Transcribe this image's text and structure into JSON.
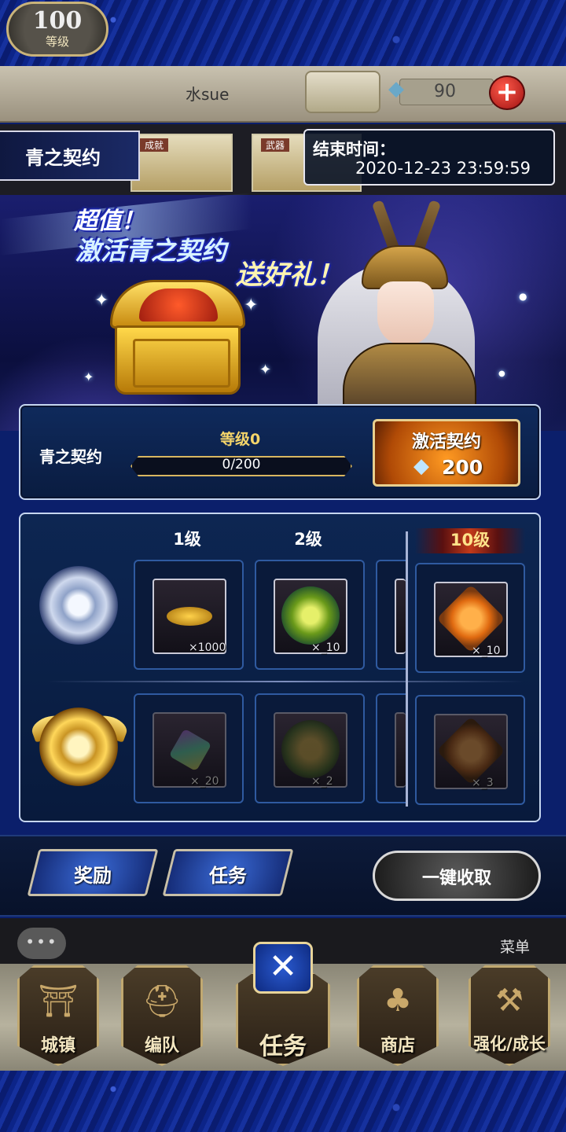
{
  "header": {
    "player_level": "100",
    "level_label": "等级",
    "player_name": "水sue",
    "gem_count": "90",
    "add_gems_label": "+"
  },
  "title_row": {
    "event_title": "青之契约",
    "bg_tab_1": "成就",
    "bg_tab_2": "武器",
    "end_time_label": "结束时间：",
    "end_time_value": "2020-12-23 23:59:59"
  },
  "banner": {
    "line1": "超值！",
    "line2": "激活青之契约",
    "line3": "送好礼！"
  },
  "contract": {
    "name": "青之契约",
    "level_text": "等级0",
    "progress_text": "0/200",
    "progress_fraction": 0,
    "activate_label": "激活契约",
    "activate_cost": "200"
  },
  "rewards": {
    "columns": [
      "1级",
      "2级",
      "10级"
    ],
    "free_row": [
      {
        "item": "gold-coins",
        "qty": "×1000"
      },
      {
        "item": "kiwi-fruit",
        "qty": "×_10"
      },
      {
        "item": "orange-star",
        "qty": "×_10"
      }
    ],
    "premium_row": [
      {
        "item": "rainbow-crystal",
        "qty": "×_20"
      },
      {
        "item": "potion-bottle",
        "qty": "×_2"
      },
      {
        "item": "potion-star",
        "qty": "×_3"
      }
    ]
  },
  "actions": {
    "rewards_tab": "奖励",
    "tasks_tab": "任务",
    "claim_all": "一键收取"
  },
  "nav": {
    "chat": "•••",
    "menu": "菜单",
    "items": [
      "城镇",
      "编队",
      "任务",
      "商店",
      "强化/成长"
    ],
    "close": "✕"
  },
  "colors": {
    "accent_gold": "#f5d56a",
    "activate_orange": "#ff9a22",
    "panel_border": "#c6d6f0",
    "tab_blue": "#3a6ad6"
  }
}
